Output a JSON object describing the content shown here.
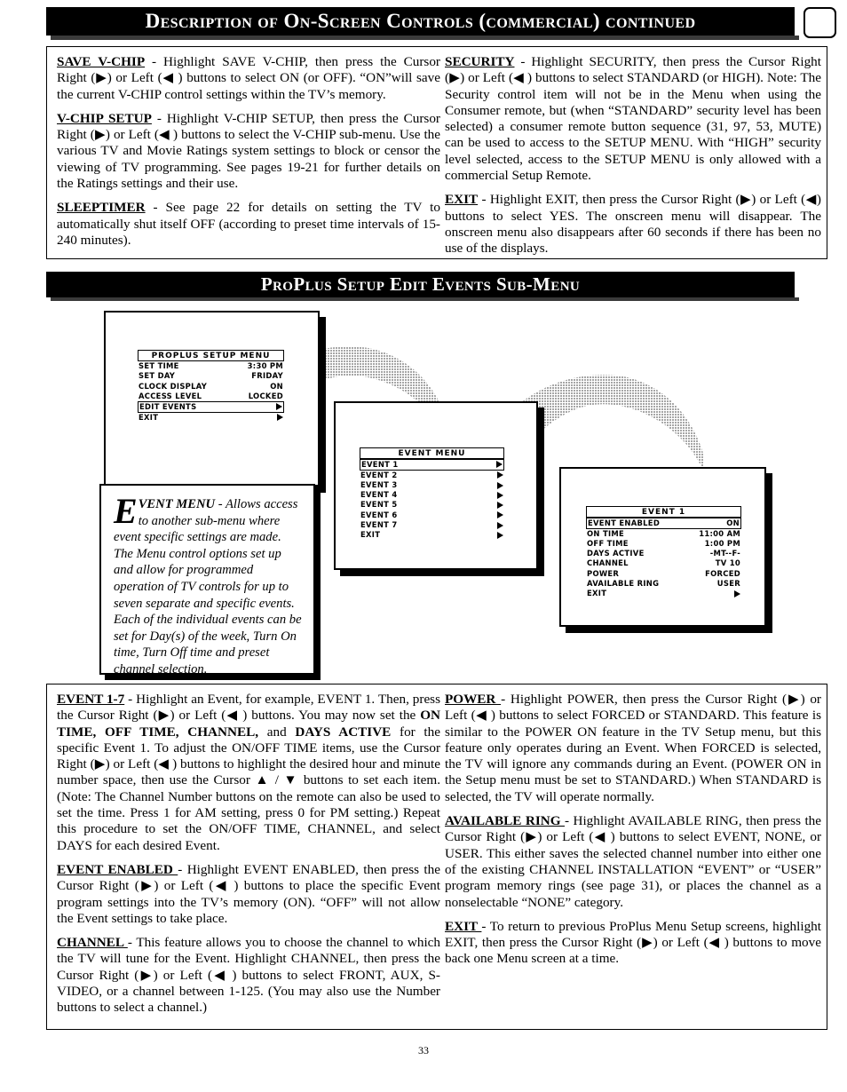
{
  "header": {
    "title": "Description of On-Screen Controls (commercial) continued",
    "badge_icon": "rounded-square-icon"
  },
  "section_header": {
    "title": "ProPlus Setup Edit Events Sub-Menu"
  },
  "top_section": {
    "left_column": [
      {
        "term": "SAVE V-CHIP",
        "text": " - Highlight SAVE V-CHIP, then press the Cursor Right (▶) or Left (◀ ) buttons to select ON (or OFF). “ON”will save the current V-CHIP control settings within the TV’s memory."
      },
      {
        "term": "V-CHIP SETUP",
        "text": " - Highlight V-CHIP SETUP, then press the Cursor Right (▶) or Left (◀ ) buttons to select the V-CHIP sub-menu. Use the various TV and Movie Ratings system settings to block or censor the viewing of TV programming. See pages 19-21 for further details on the Ratings settings and their use."
      },
      {
        "term": "SLEEPTIMER",
        "text": " - See page 22 for details on setting the TV to automatically shut itself OFF (according to preset time intervals of 15-240 minutes)."
      }
    ],
    "right_column": [
      {
        "term": "SECURITY",
        "text": "  - Highlight SECURITY, then press the Cursor Right (▶) or Left (◀ ) buttons to select STANDARD (or HIGH). Note: The Security control item will not be in the Menu when using the Consumer remote, but (when “STANDARD” security level has been selected) a consumer remote button sequence (31, 97, 53, MUTE) can be used to access to the SETUP MENU. With “HIGH” security level selected, access to the SETUP MENU is only allowed with a commercial Setup Remote."
      },
      {
        "term": "EXIT",
        "text": " - Highlight EXIT, then press the Cursor Right (▶) or Left (◀) buttons  to select YES. The onscreen menu will disappear. The onscreen menu also disappears after 60 seconds if there has been no use of the displays."
      }
    ]
  },
  "illustration": {
    "screens": [
      {
        "id": "proplus-setup-menu",
        "title": "PROPLUS SETUP MENU",
        "rows": [
          {
            "label": "SET TIME",
            "value": "3:30 PM",
            "selected": false,
            "arrow": false
          },
          {
            "label": "SET DAY",
            "value": "FRIDAY",
            "selected": false,
            "arrow": false
          },
          {
            "label": "CLOCK DISPLAY",
            "value": "ON",
            "selected": false,
            "arrow": false
          },
          {
            "label": "ACCESS LEVEL",
            "value": "LOCKED",
            "selected": false,
            "arrow": false
          },
          {
            "label": "EDIT EVENTS",
            "value": "",
            "selected": true,
            "arrow": true
          },
          {
            "label": "EXIT",
            "value": "",
            "selected": false,
            "arrow": true
          }
        ]
      },
      {
        "id": "event-menu",
        "title": "EVENT MENU",
        "rows": [
          {
            "label": "EVENT 1",
            "value": "",
            "selected": true,
            "arrow": true
          },
          {
            "label": "EVENT 2",
            "value": "",
            "selected": false,
            "arrow": true
          },
          {
            "label": "EVENT 3",
            "value": "",
            "selected": false,
            "arrow": true
          },
          {
            "label": "EVENT 4",
            "value": "",
            "selected": false,
            "arrow": true
          },
          {
            "label": "EVENT 5",
            "value": "",
            "selected": false,
            "arrow": true
          },
          {
            "label": "EVENT 6",
            "value": "",
            "selected": false,
            "arrow": true
          },
          {
            "label": "EVENT 7",
            "value": "",
            "selected": false,
            "arrow": true
          },
          {
            "label": "EXIT",
            "value": "",
            "selected": false,
            "arrow": true
          }
        ]
      },
      {
        "id": "event-1",
        "title": "EVENT 1",
        "rows": [
          {
            "label": "EVENT ENABLED",
            "value": "ON",
            "selected": true,
            "arrow": false
          },
          {
            "label": "ON TIME",
            "value": "11:00 AM",
            "selected": false,
            "arrow": false
          },
          {
            "label": "OFF TIME",
            "value": "1:00 PM",
            "selected": false,
            "arrow": false
          },
          {
            "label": "DAYS ACTIVE",
            "value": "-MT--F-",
            "selected": false,
            "arrow": false
          },
          {
            "label": "CHANNEL",
            "value": "TV 10",
            "selected": false,
            "arrow": false
          },
          {
            "label": "POWER",
            "value": "FORCED",
            "selected": false,
            "arrow": false
          },
          {
            "label": "AVAILABLE RING",
            "value": "USER",
            "selected": false,
            "arrow": false
          },
          {
            "label": "EXIT",
            "value": "",
            "selected": false,
            "arrow": true
          }
        ]
      }
    ]
  },
  "caption": {
    "dropcap": "E",
    "lead": "VENT MENU",
    "text": " - Allows access to another sub-menu where event specific settings are made. The Menu control options set up and allow for programmed operation of TV controls for up to seven separate and specific events. Each of the individual events can be set for Day(s) of the week, Turn On time, Turn Off time and preset channel selection."
  },
  "bottom_section": {
    "left_column": [
      {
        "term": "EVENT 1-7",
        "text_1": " - Highlight an Event, for example, EVENT 1. Then, press the Cursor Right (▶) or Left (◀ ) buttons. You may now set the ",
        "bold_1": "ON TIME, OFF TIME, CHANNEL,",
        "text_2": " and ",
        "bold_2": "DAYS ACTIVE",
        "text_3": " for the specific Event 1. To adjust the ON/OFF TIME items, use the Cursor Right (▶) or Left (◀ ) buttons to highlight the desired hour and minute number space, then use the Cursor ▲ / ▼ buttons to set each item. (Note: The Channel Number buttons on the remote can also be used to set the time. Press 1 for AM setting, press 0 for PM setting.) Repeat this procedure to set the ON/OFF TIME, CHANNEL, and select DAYS for each desired Event."
      },
      {
        "term": "EVENT ENABLED ",
        "text": "- Highlight EVENT ENABLED, then press the Cursor Right (▶) or Left (◀ ) buttons to place the specific Event program settings into the TV’s memory (ON). “OFF” will not allow the Event settings to take place."
      },
      {
        "term": "CHANNEL ",
        "text": "- This feature allows you to choose the channel to which the TV will tune for the Event. Highlight CHANNEL, then press the Cursor Right (▶) or Left (◀ ) buttons to select FRONT, AUX, S-VIDEO, or a channel between 1-125. (You may also use the Number buttons to select a channel.)"
      }
    ],
    "right_column": [
      {
        "term": "POWER ",
        "text": " - Highlight POWER, then press the Cursor Right (▶) or Left (◀ ) buttons to select FORCED or STANDARD. This feature is similar to the POWER ON feature in the TV Setup menu, but this feature only operates during an Event. When FORCED is selected, the TV will ignore any commands during an Event. (POWER ON in the Setup menu must be set to STANDARD.) When STANDARD is selected, the TV will operate normally."
      },
      {
        "term": "AVAILABLE RING ",
        "text": "- Highlight AVAILABLE RING, then press the Cursor Right (▶) or Left (◀ ) buttons to select EVENT, NONE, or USER. This either saves the selected channel number into either one of the existing CHANNEL INSTALLATION “EVENT” or “USER” program memory rings (see page 31), or places the channel as a nonselectable “NONE” category."
      },
      {
        "term": "EXIT ",
        "text": "- To return to previous ProPlus Menu Setup screens, highlight EXIT, then press the Cursor Right (▶) or Left (◀ ) buttons to move back one Menu screen at a time."
      }
    ]
  },
  "footer": {
    "page_number": "33"
  }
}
